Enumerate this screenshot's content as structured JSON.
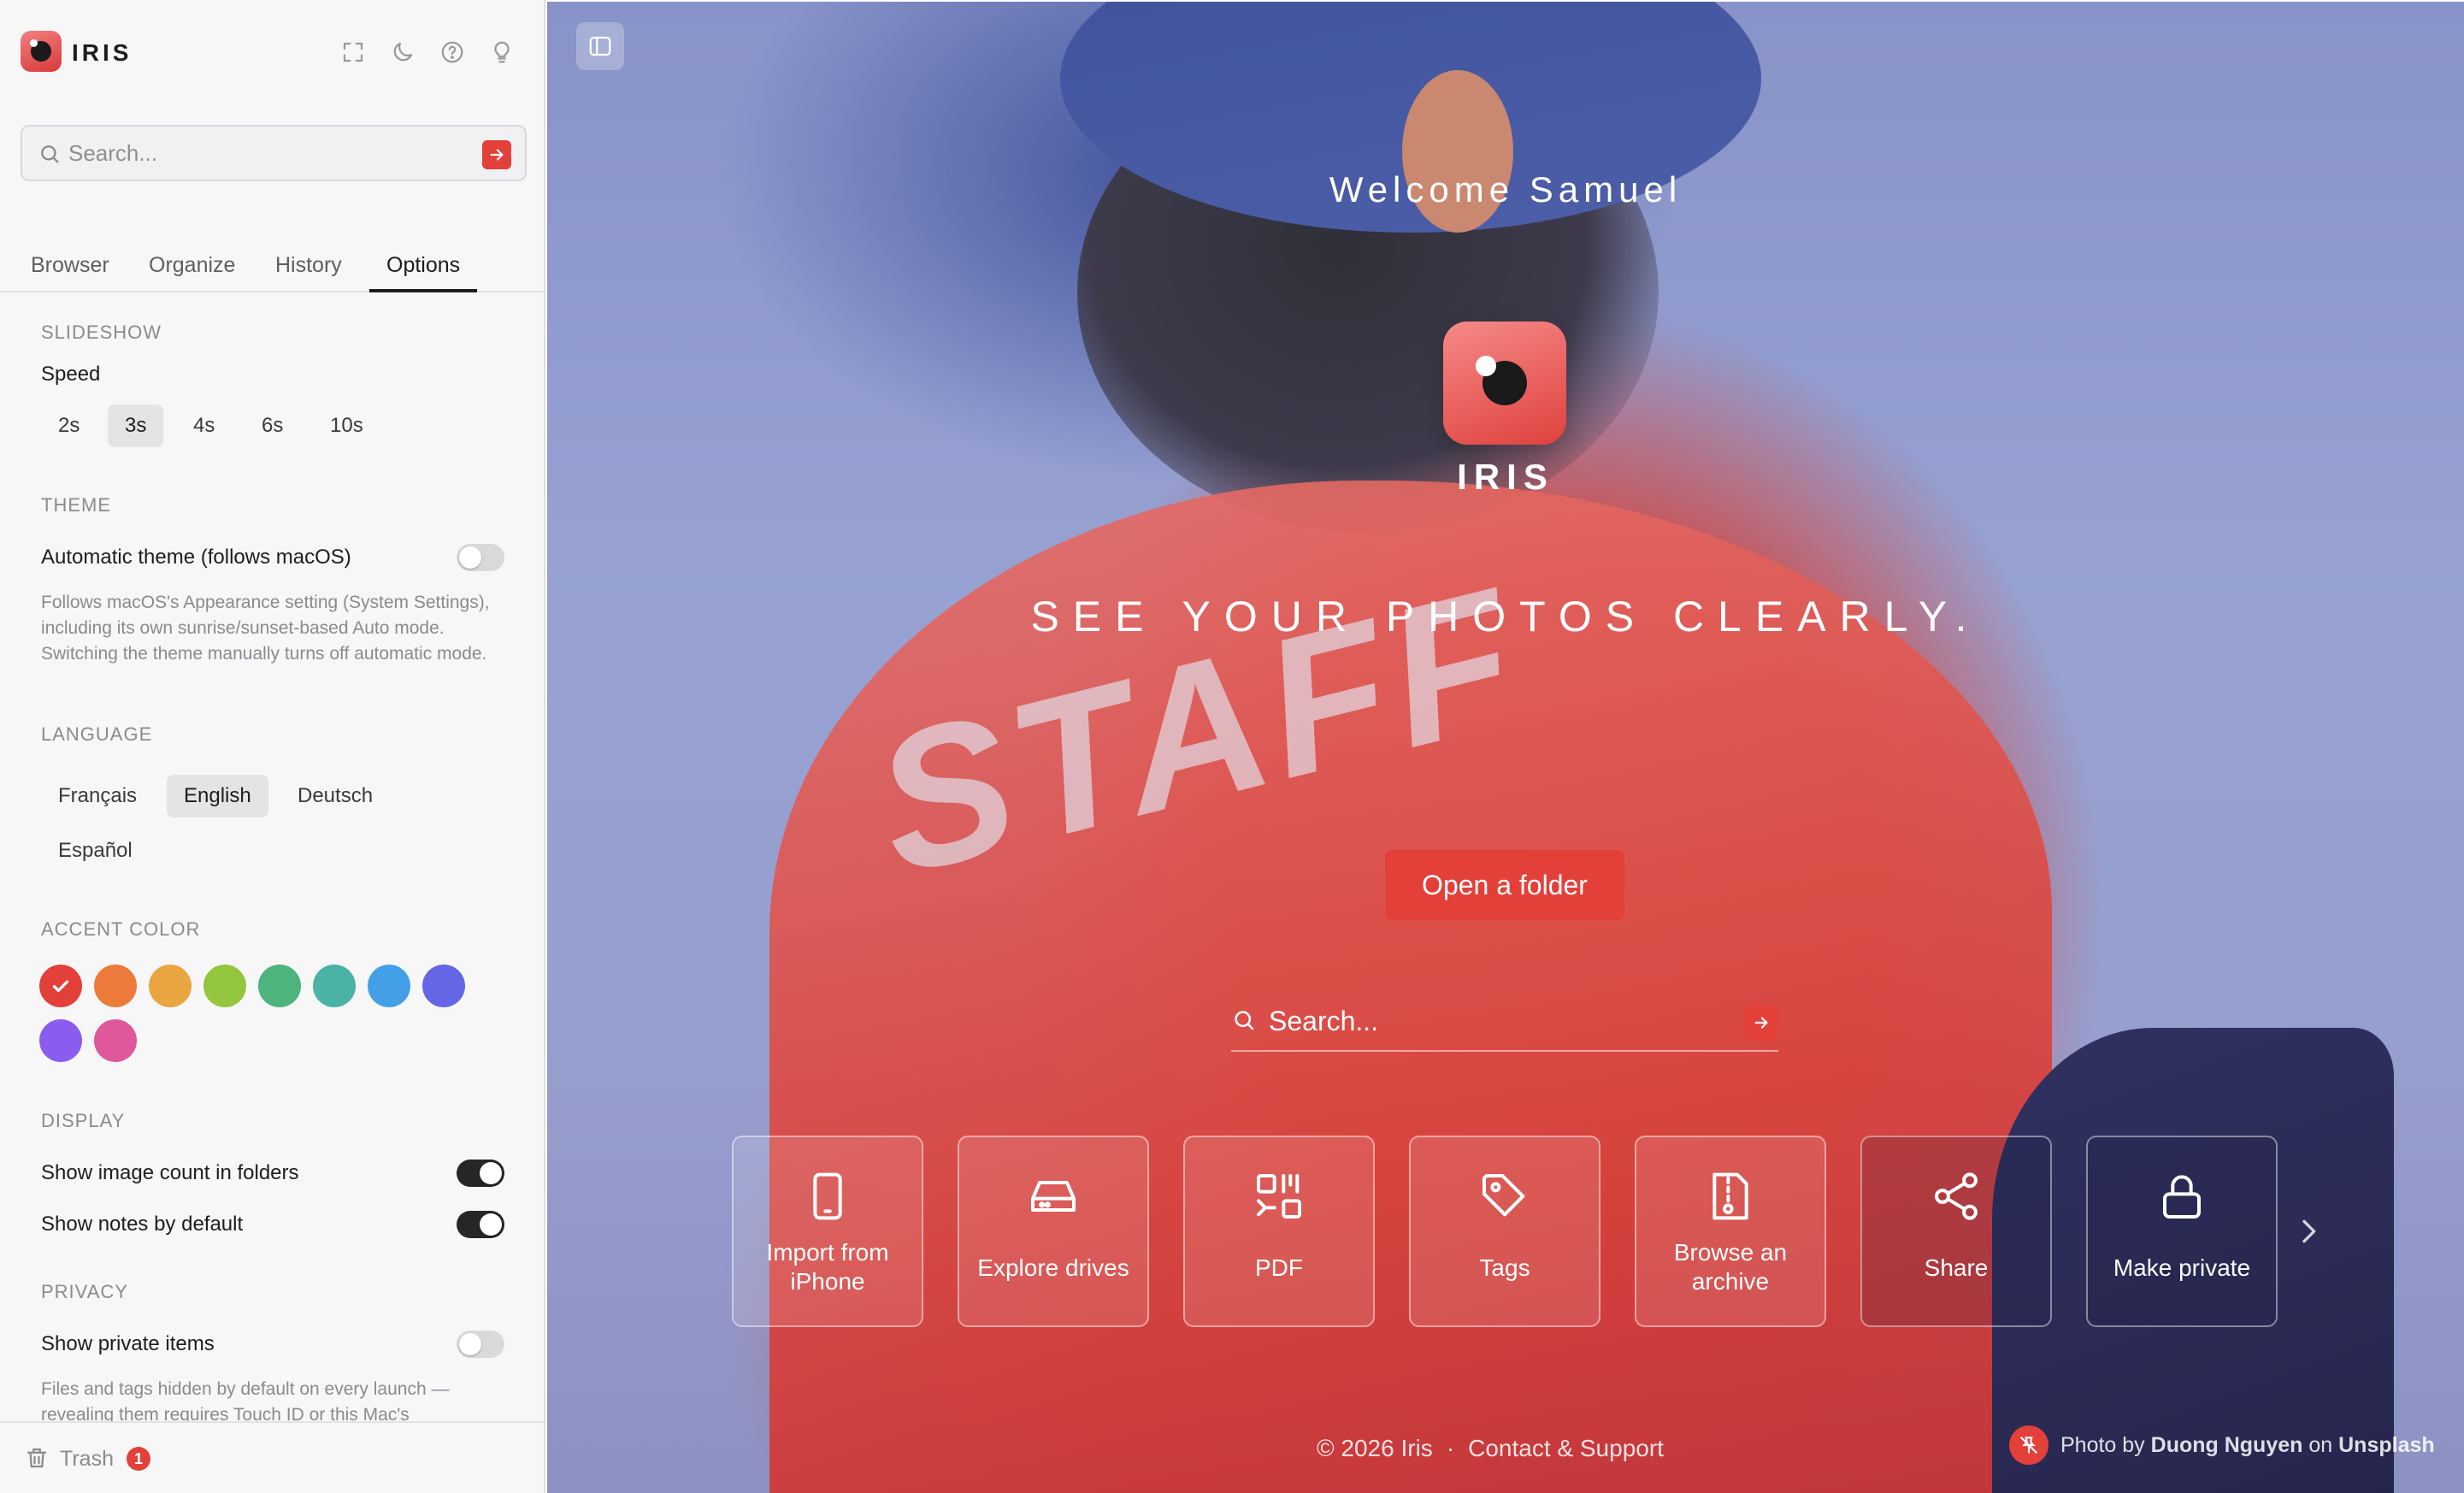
{
  "app": {
    "name": "IRIS"
  },
  "sidebar": {
    "search": {
      "placeholder": "Search..."
    },
    "tabs": [
      {
        "label": "Browser"
      },
      {
        "label": "Organize"
      },
      {
        "label": "History"
      },
      {
        "label": "Options",
        "active": true
      }
    ],
    "options": {
      "slideshow": {
        "heading": "SLIDESHOW",
        "speed_label": "Speed",
        "speeds": [
          "2s",
          "3s",
          "4s",
          "6s",
          "10s"
        ],
        "selected_speed": "3s"
      },
      "theme": {
        "heading": "THEME",
        "auto_label": "Automatic theme (follows macOS)",
        "auto_enabled": false,
        "help": "Follows macOS's Appearance setting (System Settings), including its own sunrise/sunset-based Auto mode. Switching the theme manually turns off automatic mode."
      },
      "language": {
        "heading": "LANGUAGE",
        "options": [
          "Français",
          "English",
          "Deutsch",
          "Español"
        ],
        "selected": "English"
      },
      "accent": {
        "heading": "ACCENT COLOR",
        "colors": [
          "#e3403a",
          "#ec7a3a",
          "#e8a540",
          "#93c63c",
          "#4cb47c",
          "#4ab3a6",
          "#44a0e6",
          "#6466e6",
          "#8b5cf0",
          "#e0589c"
        ],
        "selected": "#e3403a"
      },
      "display": {
        "heading": "DISPLAY",
        "image_count_label": "Show image count in folders",
        "image_count_enabled": true,
        "notes_label": "Show notes by default",
        "notes_enabled": true
      },
      "privacy": {
        "heading": "PRIVACY",
        "private_label": "Show private items",
        "private_enabled": false,
        "help": "Files and tags hidden by default on every launch — revealing them requires Touch ID or this Mac's"
      }
    },
    "footer": {
      "trash_label": "Trash",
      "trash_count": "1"
    }
  },
  "hero": {
    "welcome": "Welcome Samuel",
    "app_name": "IRIS",
    "tagline": "SEE YOUR PHOTOS CLEARLY.",
    "open_button": "Open a folder",
    "search_placeholder": "Search...",
    "tiles": [
      {
        "label": "Import from iPhone",
        "icon": "phone-icon"
      },
      {
        "label": "Explore drives",
        "icon": "drive-icon"
      },
      {
        "label": "PDF",
        "icon": "pdf-icon"
      },
      {
        "label": "Tags",
        "icon": "tag-icon"
      },
      {
        "label": "Browse an archive",
        "icon": "archive-icon"
      },
      {
        "label": "Share",
        "icon": "share-icon"
      },
      {
        "label": "Make private",
        "icon": "lock-icon"
      }
    ],
    "footer": {
      "copyright": "© 2026 Iris",
      "separator": "·",
      "support": "Contact & Support"
    },
    "credit": {
      "prefix": "Photo by",
      "author": "Duong Nguyen",
      "middle": "on",
      "source": "Unsplash"
    }
  },
  "colors": {
    "accent": "#e3403a"
  }
}
